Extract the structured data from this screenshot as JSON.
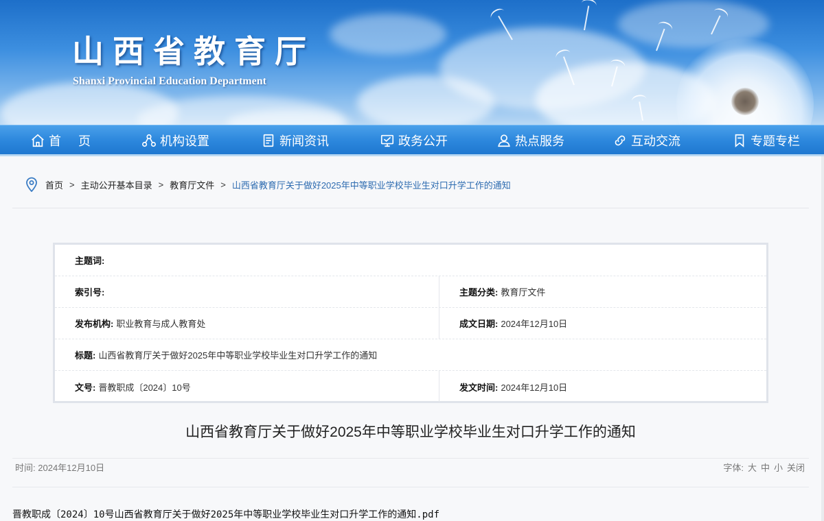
{
  "header": {
    "title": "山西省教育厅",
    "subtitle": "Shanxi Provincial Education Department"
  },
  "nav": {
    "items": [
      {
        "label": "首 页",
        "icon": "home-icon"
      },
      {
        "label": "机构设置",
        "icon": "org-chart-icon"
      },
      {
        "label": "新闻资讯",
        "icon": "document-icon"
      },
      {
        "label": "政务公开",
        "icon": "screen-check-icon"
      },
      {
        "label": "热点服务",
        "icon": "user-icon"
      },
      {
        "label": "互动交流",
        "icon": "link-icon"
      },
      {
        "label": "专题专栏",
        "icon": "bookmark-icon"
      }
    ]
  },
  "breadcrumb": {
    "icon": "location-pin-icon",
    "items": [
      "首页",
      "主动公开基本目录",
      "教育厅文件",
      "山西省教育厅关于做好2025年中等职业学校毕业生对口升学工作的通知"
    ],
    "separator": ">"
  },
  "meta": {
    "subject_words_key": "主题词:",
    "subject_words_value": "",
    "index_no_key": "索引号:",
    "index_no_value": "",
    "category_key": "主题分类:",
    "category_value": "教育厅文件",
    "publisher_key": "发布机构:",
    "publisher_value": "职业教育与成人教育处",
    "written_date_key": "成文日期:",
    "written_date_value": "2024年12月10日",
    "title_key": "标题:",
    "title_value": "山西省教育厅关于做好2025年中等职业学校毕业生对口升学工作的通知",
    "doc_no_key": "文号:",
    "doc_no_value": "晋教职成〔2024〕10号",
    "issue_time_key": "发文时间:",
    "issue_time_value": "2024年12月10日"
  },
  "article": {
    "title": "山西省教育厅关于做好2025年中等职业学校毕业生对口升学工作的通知",
    "time_label": "时间:",
    "time_value": "2024年12月10日",
    "font_label": "字体:",
    "font_large": "大",
    "font_medium": "中",
    "font_small": "小",
    "close": "关闭",
    "attachment": "晋教职成〔2024〕10号山西省教育厅关于做好2025年中等职业学校毕业生对口升学工作的通知.pdf"
  },
  "colors": {
    "nav_blue": "#2b86dc",
    "breadcrumb_current": "#2d6bb0",
    "banner_top": "#1d6fc9"
  }
}
